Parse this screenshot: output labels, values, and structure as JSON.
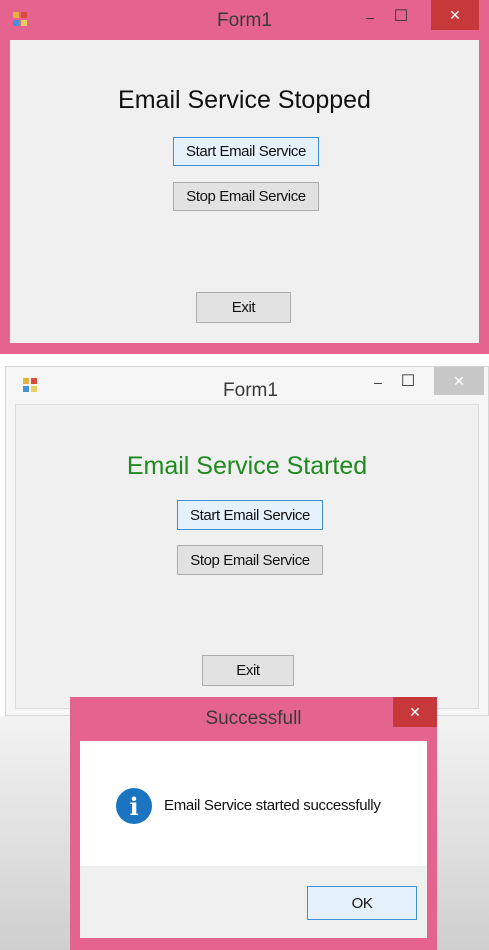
{
  "window_top": {
    "title": "Form1",
    "status_heading": "Email Service Stopped",
    "start_button": "Start Email Service",
    "stop_button": "Stop Email Service",
    "exit_button": "Exit",
    "title_bar_color": "#e4638f",
    "minimize_glyph": "–",
    "maximize_glyph": "☐",
    "close_glyph": "✕"
  },
  "window_bottom": {
    "title": "Form1",
    "status_heading": "Email Service Started",
    "status_color": "#1f8a1f",
    "start_button": "Start Email Service",
    "stop_button": "Stop Email Service",
    "exit_button": "Exit",
    "minimize_glyph": "–",
    "maximize_glyph": "☐",
    "close_glyph": "✕"
  },
  "dialog": {
    "title": "Successfull",
    "message": "Email Service started successfully",
    "ok_button": "OK",
    "icon": "info-icon",
    "icon_glyph": "i",
    "close_glyph": "✕"
  }
}
